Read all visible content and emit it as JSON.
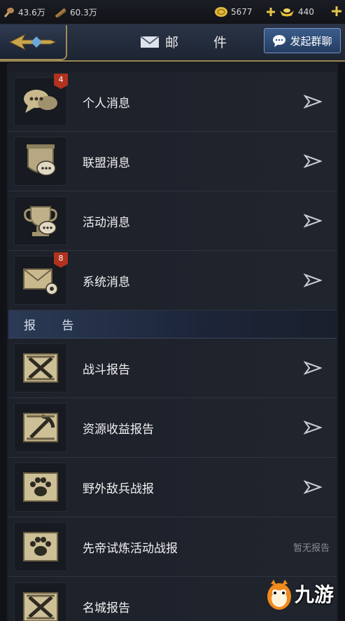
{
  "resources": {
    "food": "43.6万",
    "wood": "60.3万",
    "gold": "5677",
    "ingot": "440"
  },
  "header": {
    "title": "邮 件",
    "chat_button": "发起群聊"
  },
  "messages": [
    {
      "label": "个人消息",
      "badge": "4"
    },
    {
      "label": "联盟消息",
      "badge": ""
    },
    {
      "label": "活动消息",
      "badge": ""
    },
    {
      "label": "系统消息",
      "badge": "8"
    }
  ],
  "reports_section": "报 告",
  "reports": [
    {
      "label": "战斗报告",
      "status": ""
    },
    {
      "label": "资源收益报告",
      "status": ""
    },
    {
      "label": "野外敌兵战报",
      "status": ""
    },
    {
      "label": "先帝试炼活动战报",
      "status": "暂无报告"
    },
    {
      "label": "名城报告",
      "status": ""
    }
  ],
  "watermark": "九游",
  "colors": {
    "accent_gold": "#9a8650",
    "badge_red": "#b1321f",
    "chat_button_blue": "#3b5d8c"
  }
}
